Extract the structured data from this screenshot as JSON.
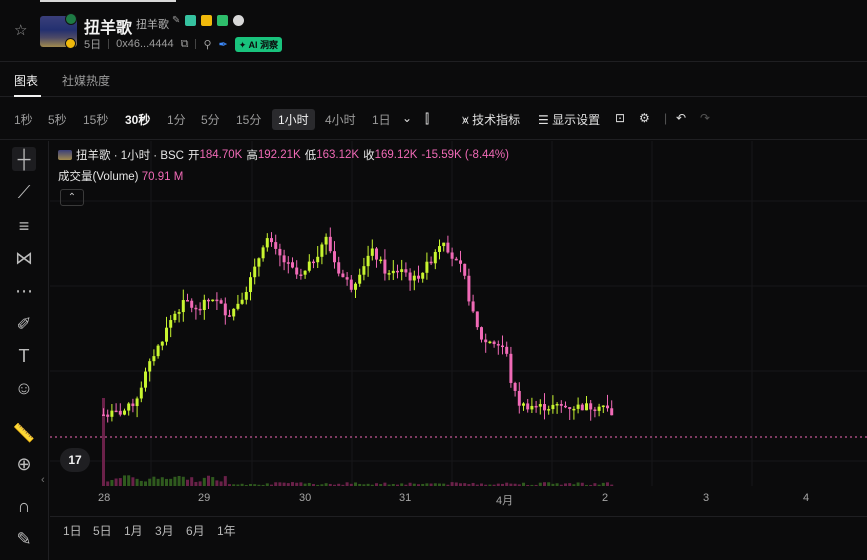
{
  "header": {
    "title": "扭羊歌",
    "subtitle": "扭羊歌",
    "age": "5日",
    "address": "0x46...4444",
    "ai_label": "AI 洞察"
  },
  "tabs": [
    {
      "label": "图表",
      "active": true
    },
    {
      "label": "社媒热度",
      "active": false
    }
  ],
  "toolbar": {
    "intervals": [
      "1秒",
      "5秒",
      "15秒",
      "30秒",
      "1分",
      "5分",
      "15分",
      "1小时",
      "4小时",
      "1日"
    ],
    "bold_interval": "30秒",
    "selected_interval": "1小时",
    "indicators_label": "技术指标",
    "display_label": "显示设置"
  },
  "legend": {
    "symbol": "扭羊歌 · 1小时 · BSC",
    "open_label": "开",
    "open_value": "184.70K",
    "high_label": "高",
    "high_value": "192.21K",
    "low_label": "低",
    "low_value": "163.12K",
    "close_label": "收",
    "close_value": "169.12K",
    "change": "-15.59K (-8.44%)",
    "volume_label": "成交量(Volume)",
    "volume_value": "70.91 M"
  },
  "x_axis": [
    "28",
    "29",
    "30",
    "31",
    "4月",
    "2",
    "3",
    "4"
  ],
  "ranges": [
    "1日",
    "5日",
    "1月",
    "3月",
    "6月",
    "1年"
  ],
  "colors": {
    "up": "#c8f530",
    "down": "#f06ab6",
    "price_line": "#f06ab6"
  },
  "chart_data": {
    "type": "candlestick",
    "timeframe": "1小时",
    "x_ticks": [
      "28",
      "29",
      "30",
      "31",
      "4月",
      "2",
      "3",
      "4"
    ],
    "last_close": "169.12K",
    "shape": [
      10,
      10,
      10.2,
      10.5,
      11,
      11.8,
      13,
      15,
      18,
      23,
      28,
      32,
      37,
      40,
      44,
      48,
      52,
      55,
      57,
      59,
      60,
      58,
      56,
      57,
      59,
      61,
      62,
      60,
      58,
      56,
      55,
      57,
      60,
      63,
      66,
      70,
      74,
      80,
      86,
      88,
      85,
      82,
      80,
      78,
      76,
      74,
      72,
      71,
      73,
      76,
      79,
      82,
      86,
      88,
      83,
      78,
      74,
      71,
      69,
      67,
      70,
      74,
      77,
      80,
      82,
      80,
      77,
      74,
      72,
      73,
      74,
      75,
      73,
      71,
      70,
      72,
      74,
      76,
      79,
      83,
      86,
      88,
      84,
      80,
      77,
      75,
      70,
      62,
      54,
      48,
      44,
      42,
      43,
      42,
      41,
      40,
      36,
      25,
      19,
      15,
      14,
      14,
      14,
      13.5,
      13.5,
      13.5,
      13.5,
      13.5,
      13.5,
      13.5,
      13.5,
      13.5,
      13.5,
      13.5,
      13.5,
      13.5,
      13.5,
      13.5,
      15,
      14,
      12,
      9
    ]
  }
}
